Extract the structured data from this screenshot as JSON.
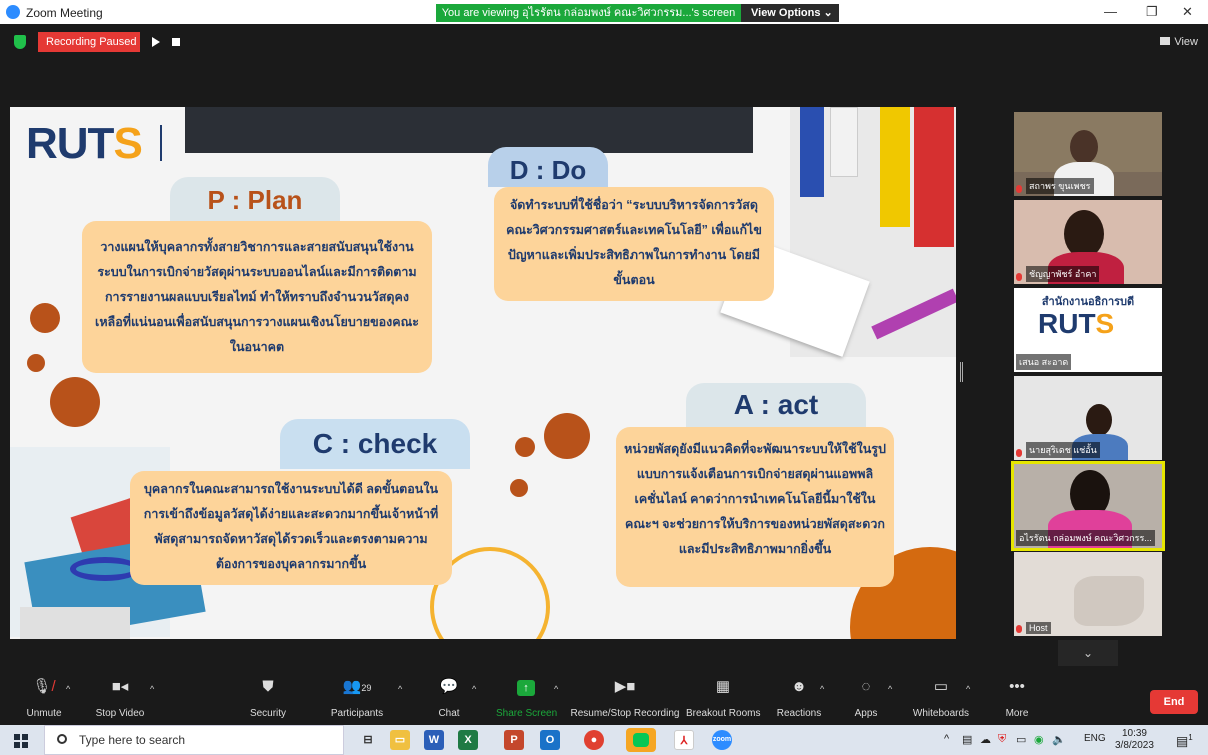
{
  "window": {
    "title": "Zoom Meeting"
  },
  "banner": {
    "text": "You are viewing อุไรรัตน กล่อมพงษ์ คณะวิศวกรรม...'s screen",
    "view_options": "View Options  ⌄"
  },
  "recording": {
    "status": "Recording Paused",
    "view_label": "View"
  },
  "slide": {
    "logo_text": "RUT",
    "logo_s": "S",
    "plan_title": "P : Plan",
    "plan_body": "วางแผนให้บุคลากรทั้งสายวิชาการและสายสนับสนุนใช้งานระบบในการเบิกจ่ายวัสดุผ่านระบบออนไลน์และมีการติดตามการรายงานผลแบบเรียลไทม์ ทำให้ทราบถึงจำนวนวัสดุคงเหลือที่แน่นอนเพื่อสนับสนุนการวางแผนเชิงนโยบายของคณะในอนาคต",
    "do_title": "D : Do",
    "do_body": "จัดทำระบบที่ใช้ชื่อว่า “ระบบบริหารจัดการวัสดุ คณะวิศวกรรมศาสตร์และเทคโนโลยี” เพื่อแก้ไขปัญหาและเพิ่มประสิทธิภาพในการทำงาน โดยมีขั้นตอน",
    "check_title": "C : check",
    "check_body": "บุคลากรในคณะสามารถใช้งานระบบได้ดี ลดขั้นตอนในการเข้าถึงข้อมูลวัสดุได้ง่ายและสะดวกมากขึ้นเจ้าหน้าที่พัสดุสามารถจัดหาวัสดุได้รวดเร็วและตรงตามความต้องการของบุคลากรมากขึ้น",
    "act_title": "A : act",
    "act_body": "หน่วยพัสดุยังมีแนวคิดที่จะพัฒนาระบบให้ใช้ในรูปแบบการแจ้งเตือนการเบิกจ่ายสดุผ่านแอพพลิเคชั่นไลน์ คาดว่าการนำเทคโนโลยีนี้มาใช้ในคณะฯ จะช่วยการให้บริการของหน่วยพัสดุสะดวกและมีประสิทธิภาพมากยิ่งขึ้น"
  },
  "gallery": [
    {
      "name": "สถาพร ขุนเพชร"
    },
    {
      "name": "ชัญญาพัชร์ อำคา"
    },
    {
      "name": "เสนอ สะอาด",
      "logo_title": "สำนักงานอธิการบดี"
    },
    {
      "name": "นายสุริเดช แช่อั้น"
    },
    {
      "name": "อไรรัตน กล่อมพงษ์ คณะวิศวกรร..."
    },
    {
      "name": "Host"
    }
  ],
  "toolbar": {
    "unmute": "Unmute",
    "stop_video": "Stop Video",
    "security": "Security",
    "participants": "Participants",
    "participants_count": "29",
    "chat": "Chat",
    "share_screen": "Share Screen",
    "resume_recording": "Resume/Stop Recording",
    "breakout": "Breakout Rooms",
    "reactions": "Reactions",
    "apps": "Apps",
    "whiteboards": "Whiteboards",
    "more": "More",
    "end": "End"
  },
  "taskbar": {
    "search_placeholder": "Type here to search",
    "lang": "ENG",
    "time": "10:39",
    "date": "3/8/2023",
    "notif_count": "1"
  },
  "colors": {
    "accent_blue": "#1f3b6e",
    "box_peach": "#fdd49a",
    "recording_red": "#e53935",
    "share_green": "#1ba83b",
    "dot_brown": "#b8521a"
  }
}
